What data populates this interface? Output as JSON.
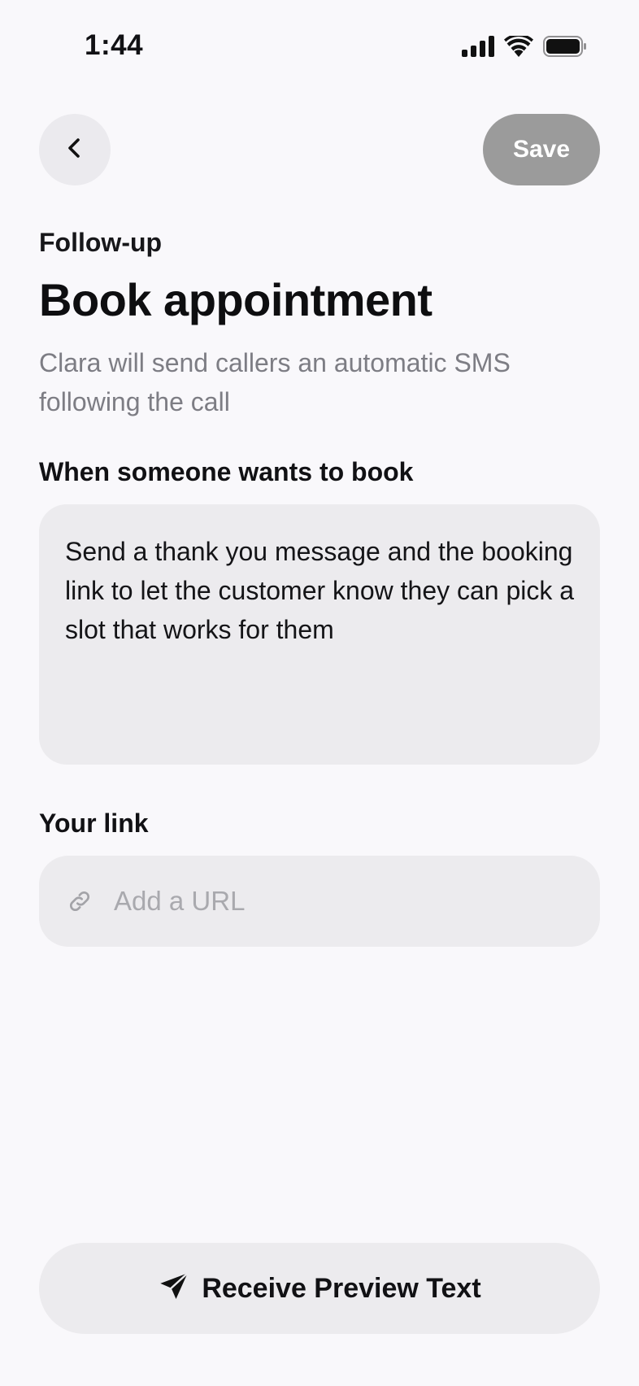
{
  "status_bar": {
    "time": "1:44",
    "icons": [
      "cellular-signal-icon",
      "wifi-icon",
      "battery-icon"
    ]
  },
  "header": {
    "back_icon": "chevron-left-icon",
    "save_label": "Save"
  },
  "content": {
    "eyebrow": "Follow-up",
    "title": "Book appointment",
    "description": "Clara will send callers an automatic SMS following the call",
    "trigger_label": "When someone wants to book",
    "message_value": "Send a thank you message and the booking link to let the customer know they can pick a slot that works for them",
    "link_label": "Your link",
    "link_icon": "link-icon",
    "link_placeholder": "Add a URL"
  },
  "footer": {
    "preview_icon": "paper-plane-icon",
    "preview_label": "Receive Preview Text"
  },
  "colors": {
    "background": "#f9f8fb",
    "field_background": "#ecebee",
    "save_button_disabled": "#9b9b9b",
    "muted_text": "#7d7d84",
    "placeholder_text": "#a9a9ae"
  }
}
